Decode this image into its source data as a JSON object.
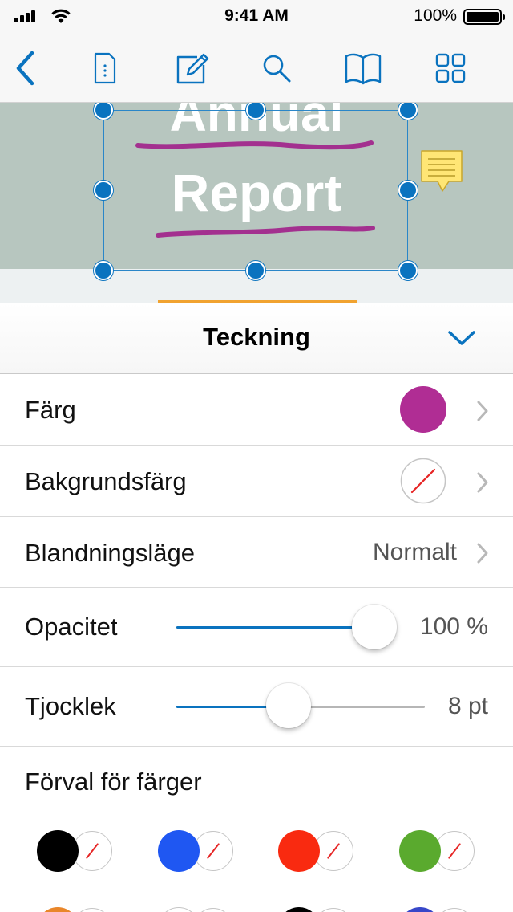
{
  "status_bar": {
    "time": "9:41 AM",
    "battery_percent": "100%"
  },
  "toolbar": {
    "icons": [
      "back-chevron-icon",
      "document-outline-icon",
      "edit-pencil-icon",
      "search-icon",
      "book-icon",
      "grid-icon"
    ],
    "accent": "#0a73bf"
  },
  "document": {
    "title_line1": "Annual",
    "title_line2": "Report",
    "band_color": "#b7c6bf",
    "ink_color": "#a3308f",
    "note_color": "#ffe675"
  },
  "panel": {
    "title": "Teckning",
    "tab_indicator_color": "#f1a330",
    "rows": {
      "color": {
        "label": "Färg",
        "value_color": "#b02d94"
      },
      "background": {
        "label": "Bakgrundsfärg",
        "value": "none"
      },
      "blend": {
        "label": "Blandningsläge",
        "value": "Normalt"
      },
      "opacity": {
        "label": "Opacitet",
        "value": "100 %",
        "level": 1.0
      },
      "thickness": {
        "label": "Tjocklek",
        "value": "8 pt",
        "level": 0.45
      }
    },
    "presets": {
      "label": "Förval för färger",
      "items": [
        {
          "stroke": "#000000",
          "fill": "none"
        },
        {
          "stroke": "#1f57f2",
          "fill": "none"
        },
        {
          "stroke": "#f92a10",
          "fill": "none"
        },
        {
          "stroke": "#5aaa2e",
          "fill": "none"
        }
      ],
      "partial_row": [
        "#e9862a",
        "#ffffff",
        "#ffffff",
        "#ffffff",
        "#000000",
        "#ffffff",
        "#3747c9",
        "#ffffff"
      ]
    }
  }
}
